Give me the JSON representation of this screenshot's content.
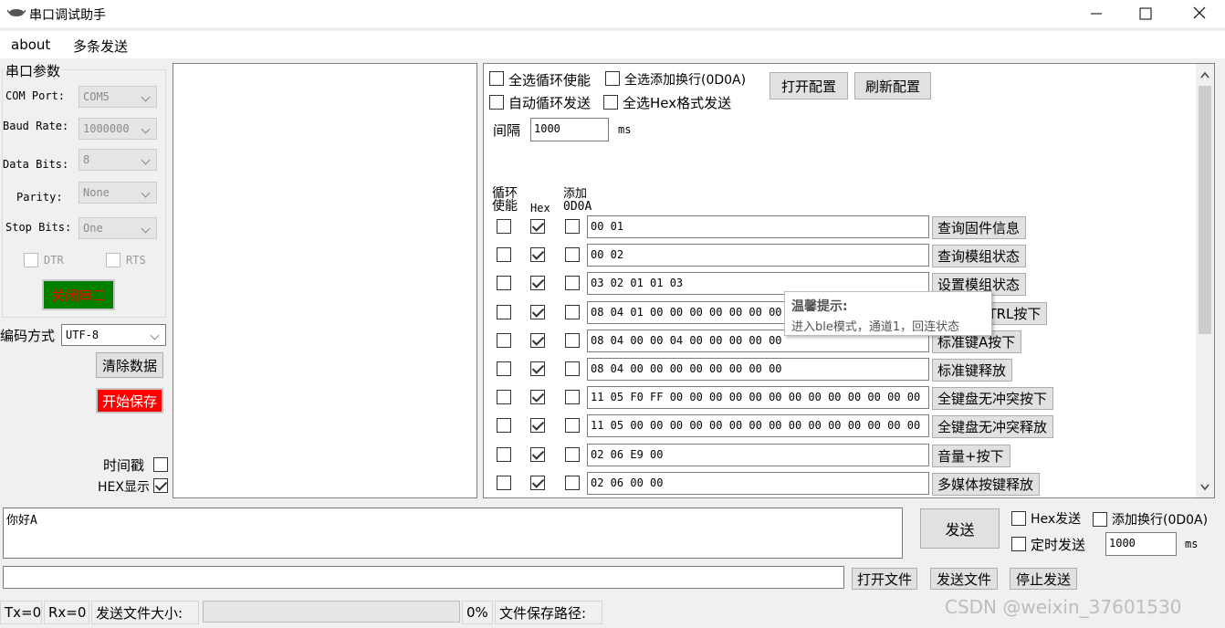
{
  "window": {
    "title": "串口调试助手"
  },
  "menu": {
    "about": "about",
    "multi_send": "多条发送"
  },
  "serial": {
    "group_title": "串口参数",
    "com_label": "COM Port:",
    "com_value": "COM5",
    "baud_label": "Baud Rate:",
    "baud_value": "1000000",
    "databits_label": "Data Bits:",
    "databits_value": "8",
    "parity_label": "Parity:",
    "parity_value": "None",
    "stopbits_label": "Stop Bits:",
    "stopbits_value": "One",
    "dtr": "DTR",
    "rts": "RTS",
    "open_close_button": "关闭串口"
  },
  "encoding": {
    "label": "编码方式",
    "value": "UTF-8"
  },
  "left_buttons": {
    "clear": "清除数据",
    "save": "开始保存",
    "timestamp": "时间戳",
    "hex_display": "HEX显示"
  },
  "multi": {
    "select_all_loop": "全选循环使能",
    "select_all_newline": "全选添加换行(0D0A)",
    "auto_loop_send": "自动循环发送",
    "select_all_hex": "全选Hex格式发送",
    "open_config": "打开配置",
    "refresh_config": "刷新配置",
    "interval_label": "间隔",
    "interval_value": "1000",
    "interval_unit": "ms",
    "col_loop": "循环\n使能",
    "col_hex": "Hex",
    "col_add": "添加\n0D0A",
    "rows": [
      {
        "data": "00 01",
        "label": "查询固件信息",
        "loop": false,
        "hex": true,
        "add": false
      },
      {
        "data": "00 02",
        "label": "查询模组状态",
        "loop": false,
        "hex": true,
        "add": false
      },
      {
        "data": "03 02 01 01 03",
        "label": "设置模组状态",
        "loop": false,
        "hex": true,
        "add": false
      },
      {
        "data": "08 04 01 00 00 00 00 00 00 00",
        "label": "标准键CTRL按下",
        "loop": false,
        "hex": true,
        "add": false
      },
      {
        "data": "08 04 00 00 04 00 00 00 00 00",
        "label": "标准键A按下",
        "loop": false,
        "hex": true,
        "add": false
      },
      {
        "data": "08 04 00 00 00 00 00 00 00 00",
        "label": "标准键释放",
        "loop": false,
        "hex": true,
        "add": false
      },
      {
        "data": "11 05 F0 FF 00 00 00 00 00 00 00 00 00 00 00 00 00",
        "label": "全键盘无冲突按下",
        "loop": false,
        "hex": true,
        "add": false
      },
      {
        "data": "11 05 00 00 00 00 00 00 00 00 00 00 00 00 00 00 00",
        "label": "全键盘无冲突释放",
        "loop": false,
        "hex": true,
        "add": false
      },
      {
        "data": "02 06 E9 00",
        "label": "音量+按下",
        "loop": false,
        "hex": true,
        "add": false
      },
      {
        "data": "02 06 00 00",
        "label": "多媒体按键释放",
        "loop": false,
        "hex": true,
        "add": false
      }
    ],
    "tooltip": {
      "title": "温馨提示:",
      "body": "进入ble模式，通道1，回连状态"
    }
  },
  "send": {
    "text": "你好A",
    "send_button": "发送",
    "hex_send": "Hex发送",
    "add_newline": "添加换行(0D0A)",
    "timed_send": "定时发送",
    "timer_value": "1000",
    "timer_unit": "ms",
    "open_file": "打开文件",
    "send_file": "发送文件",
    "stop_send": "停止发送"
  },
  "status": {
    "tx": "Tx=0",
    "rx": "Rx=0",
    "file_size_label": "发送文件大小:",
    "progress_percent": "0%",
    "save_path_label": "文件保存路径:"
  },
  "watermark": "CSDN @weixin_37601530",
  "colors": {
    "open_button_bg": "#008000",
    "save_button_bg": "#ff0000",
    "open_button_text": "#ff0000"
  }
}
